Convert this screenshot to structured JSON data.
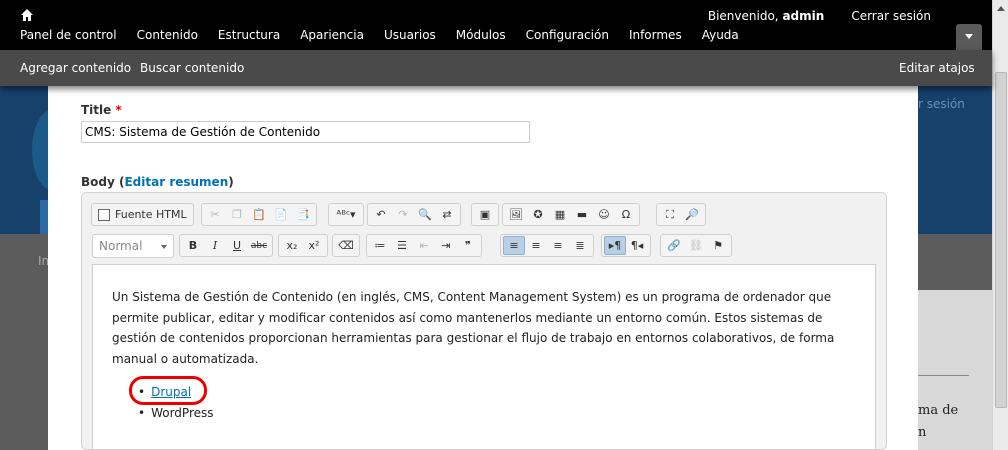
{
  "toolbar": {
    "menu": [
      "Panel de control",
      "Contenido",
      "Estructura",
      "Apariencia",
      "Usuarios",
      "Módulos",
      "Configuración",
      "Informes",
      "Ayuda"
    ],
    "welcome": "Bienvenido,",
    "username": "admin",
    "logout": "Cerrar sesión"
  },
  "shortcuts": {
    "add_content": "Agregar contenido",
    "find_content": "Buscar contenido",
    "edit_shortcuts": "Editar atajos"
  },
  "background": {
    "login_hint": "r sesión",
    "breadcrumb": "In",
    "side_text_1": "ma de",
    "side_text_2": "n"
  },
  "form": {
    "title_label": "Title",
    "required_mark": "*",
    "title_value": "CMS: Sistema de Gestión de Contenido",
    "body_label": "Body",
    "edit_summary": "Editar resumen"
  },
  "editor": {
    "source_label": "Fuente HTML",
    "format_value": "Normal",
    "paragraph": "Un Sistema de Gestión de Contenido (en inglés, CMS, Content Management System) es un programa de ordenador que permite publicar, editar y modificar contenidos así como mantenerlos mediante un entorno común. Estos sistemas de gestión de contenidos proporcionan herramientas para gestionar el flujo de trabajo en entornos colaborativos, de forma manual o automatizada.",
    "list": [
      "Drupal",
      "WordPress"
    ]
  },
  "colors": {
    "toolbar_bg": "#000000",
    "shortcuts_bg": "#4a4a4a",
    "link": "#0071b3",
    "highlight": "#e00000"
  }
}
